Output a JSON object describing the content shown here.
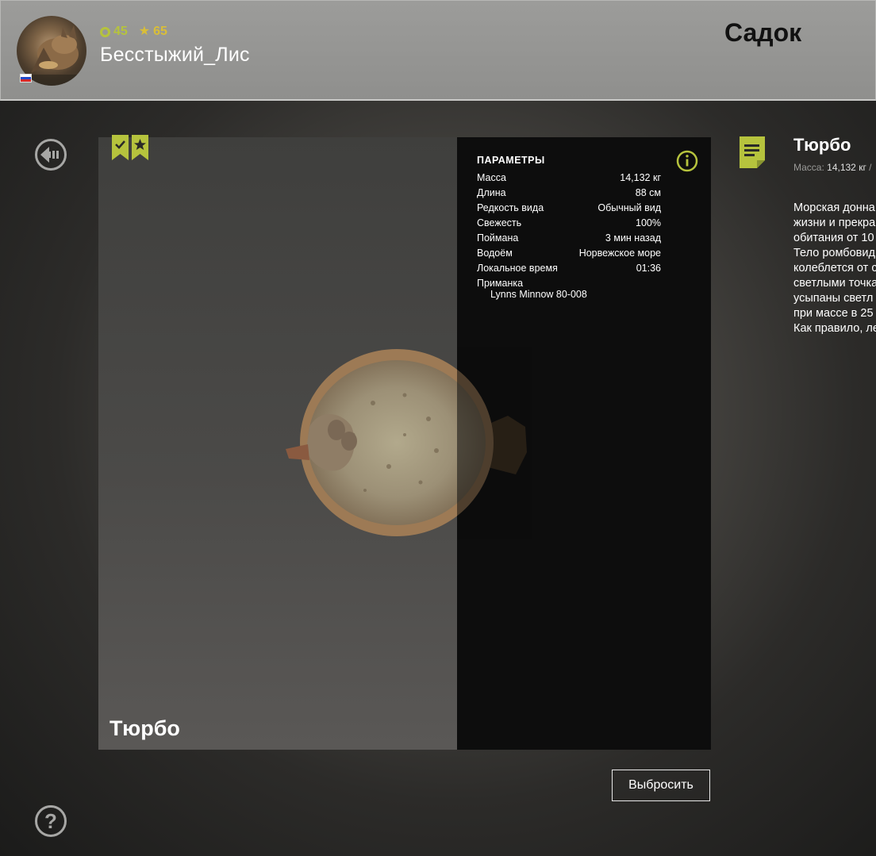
{
  "header": {
    "username": "Бесстыжий_Лис",
    "level": "45",
    "rating": "65",
    "screen_title": "Садок",
    "accent_color": "#b6c33d"
  },
  "fish": {
    "name": "Тюрбо"
  },
  "params": {
    "title": "ПАРАМЕТРЫ",
    "rows": [
      {
        "label": "Масса",
        "value": "14,132 кг"
      },
      {
        "label": "Длина",
        "value": "88 см"
      },
      {
        "label": "Редкость вида",
        "value": "Обычный вид"
      },
      {
        "label": "Свежесть",
        "value": "100%"
      },
      {
        "label": "Поймана",
        "value": "3 мин назад"
      },
      {
        "label": "Водоём",
        "value": "Норвежское море"
      },
      {
        "label": "Локальное время",
        "value": "01:36"
      }
    ],
    "bait_label": "Приманка",
    "bait_value": "Lynns Minnow 80-008"
  },
  "actions": {
    "discard_label": "Выбросить"
  },
  "description": {
    "title": "Тюрбо",
    "mass_label": "Масса:",
    "mass_value": "14,132 кг",
    "mass_tail": "/",
    "lines": [
      "Морская донна",
      "жизни и прекра",
      "обитания от 10",
      "Тело ромбовид",
      "колеблется от с",
      "светлыми точка",
      "усыпаны светл",
      "при массе в 25",
      "Как правило, ле"
    ]
  },
  "help": {
    "glyph": "?"
  }
}
